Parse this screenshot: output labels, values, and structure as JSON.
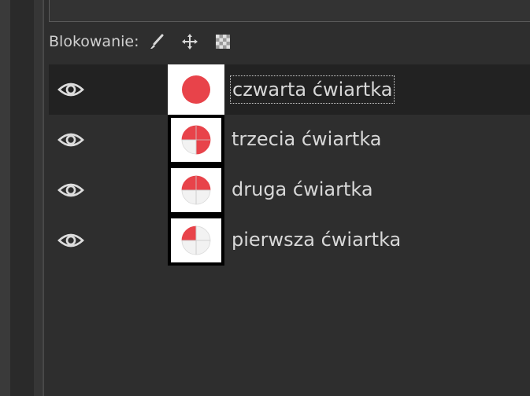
{
  "lock": {
    "label": "Blokowanie:",
    "icons": [
      "brush-icon",
      "move-icon",
      "checkerboard-icon"
    ]
  },
  "layers": [
    {
      "name": "czwarta ćwiartka",
      "visible": true,
      "selected": true,
      "quarters_filled": 4
    },
    {
      "name": "trzecia ćwiartka",
      "visible": true,
      "selected": false,
      "quarters_filled": 3
    },
    {
      "name": "druga ćwiartka",
      "visible": true,
      "selected": false,
      "quarters_filled": 2
    },
    {
      "name": "pierwsza ćwiartka",
      "visible": true,
      "selected": false,
      "quarters_filled": 1
    }
  ],
  "colors": {
    "fill": "#e8434a",
    "empty": "#f2f2f2",
    "selected_row": "#222222",
    "panel": "#2e2e2e"
  }
}
